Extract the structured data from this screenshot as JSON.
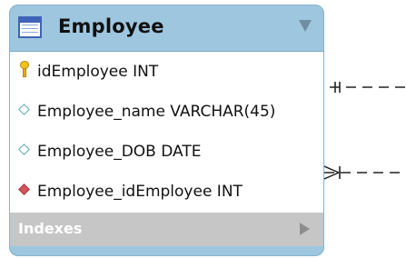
{
  "table": {
    "title": "Employee",
    "columns": [
      {
        "text": "idEmployee INT",
        "icon": "primary-key-icon"
      },
      {
        "text": "Employee_name VARCHAR(45)",
        "icon": "column-diamond-icon"
      },
      {
        "text": "Employee_DOB DATE",
        "icon": "column-diamond-icon"
      },
      {
        "text": "Employee_idEmployee INT",
        "icon": "foreign-key-diamond-icon"
      }
    ],
    "indexes_label": "Indexes"
  },
  "colors": {
    "header": "#9ec6df",
    "indexes_bg": "#c6c6c6",
    "key": "#f1c21c",
    "fk_diamond": "#d2545c",
    "diamond_outline": "#58a7b8"
  }
}
